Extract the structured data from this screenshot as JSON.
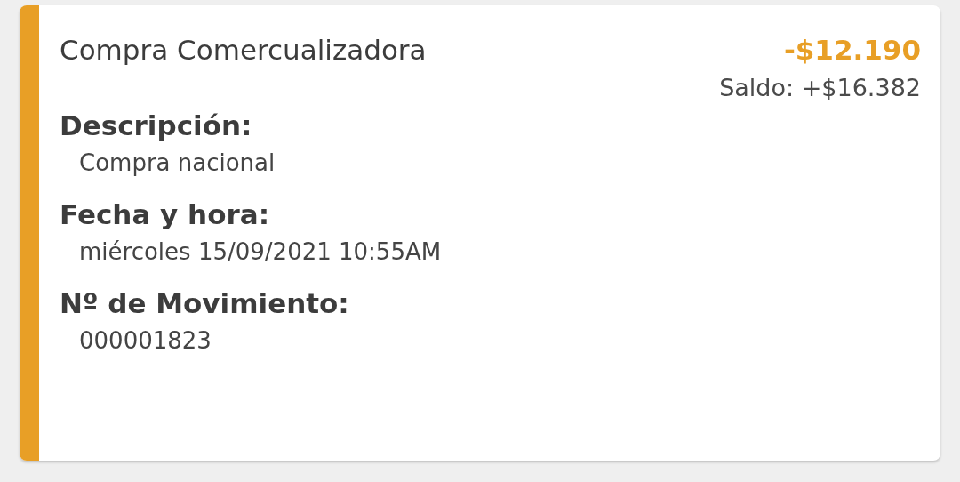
{
  "transaction": {
    "title": "Compra Comercualizadora",
    "amount": "-$12.190",
    "balance": "Saldo: +$16.382",
    "fields": [
      {
        "label": "Descripción:",
        "value": "Compra nacional"
      },
      {
        "label": "Fecha y hora:",
        "value": "miércoles 15/09/2021 10:55AM"
      },
      {
        "label": "Nº de Movimiento:",
        "value": "000001823"
      }
    ]
  }
}
